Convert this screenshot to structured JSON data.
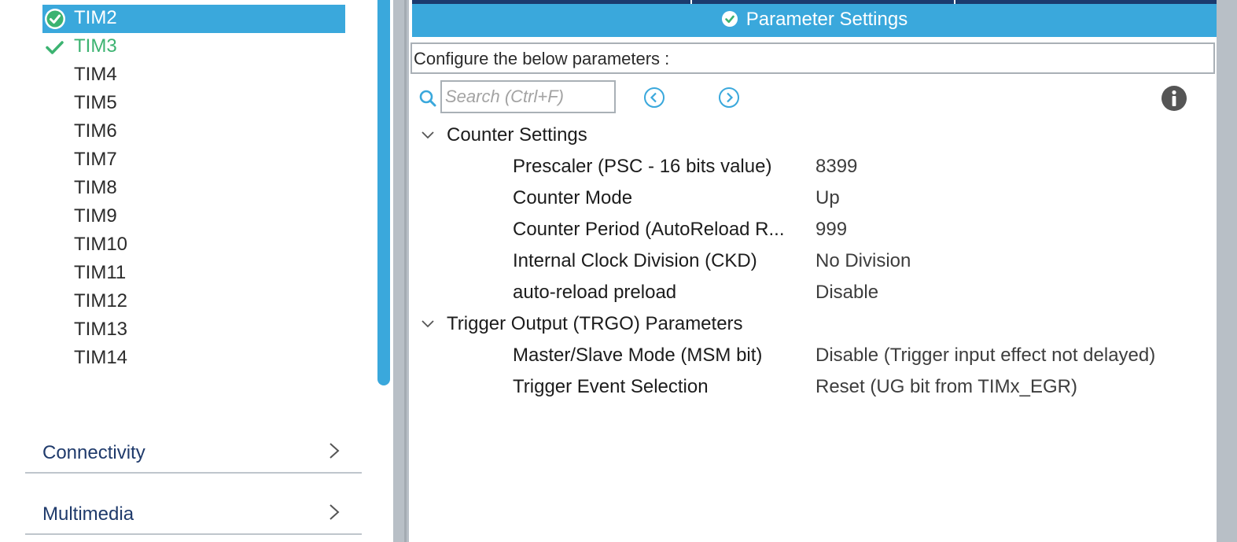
{
  "sidebar": {
    "timers": [
      {
        "label": "TIM2",
        "state": "selected"
      },
      {
        "label": "TIM3",
        "state": "enabled"
      },
      {
        "label": "TIM4",
        "state": "none"
      },
      {
        "label": "TIM5",
        "state": "none"
      },
      {
        "label": "TIM6",
        "state": "none"
      },
      {
        "label": "TIM7",
        "state": "none"
      },
      {
        "label": "TIM8",
        "state": "none"
      },
      {
        "label": "TIM9",
        "state": "none"
      },
      {
        "label": "TIM10",
        "state": "none"
      },
      {
        "label": "TIM11",
        "state": "none"
      },
      {
        "label": "TIM12",
        "state": "none"
      },
      {
        "label": "TIM13",
        "state": "none"
      },
      {
        "label": "TIM14",
        "state": "none"
      }
    ],
    "categories": [
      {
        "label": "Connectivity"
      },
      {
        "label": "Multimedia"
      }
    ]
  },
  "panel": {
    "header_title": "Parameter Settings",
    "configure_text": "Configure the below parameters :",
    "search_placeholder": "Search (Ctrl+F)",
    "sections": [
      {
        "title": "Counter Settings",
        "params": [
          {
            "name": "Prescaler (PSC - 16 bits value)",
            "value": "8399"
          },
          {
            "name": "Counter Mode",
            "value": "Up"
          },
          {
            "name": "Counter Period (AutoReload R...",
            "value": "999"
          },
          {
            "name": "Internal Clock Division (CKD)",
            "value": "No Division"
          },
          {
            "name": "auto-reload preload",
            "value": "Disable"
          }
        ]
      },
      {
        "title": "Trigger Output (TRGO) Parameters",
        "params": [
          {
            "name": "Master/Slave Mode (MSM bit)",
            "value": "Disable (Trigger input effect not delayed)"
          },
          {
            "name": "Trigger Event Selection",
            "value": "Reset (UG bit from TIMx_EGR)"
          }
        ]
      }
    ]
  },
  "colors": {
    "accent": "#3aa8dc",
    "enabled_green": "#3cb371",
    "category_text": "#1f3a6b",
    "divider": "#b8bfc6"
  },
  "icons": {
    "selected_timer": "check-circle-icon",
    "enabled_timer": "checkmark-icon",
    "header": "check-circle-icon",
    "search": "search-icon",
    "prev": "arrow-left-circle-icon",
    "next": "arrow-right-circle-icon",
    "info": "info-icon",
    "section_toggle": "chevron-down-icon",
    "category": "chevron-right-icon"
  }
}
